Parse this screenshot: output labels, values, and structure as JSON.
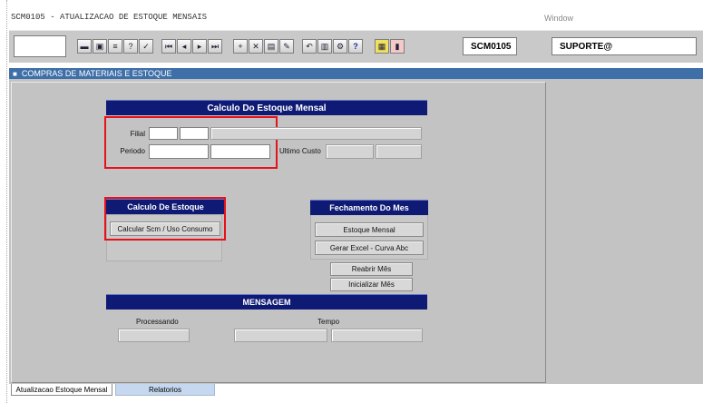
{
  "window": {
    "title": "SCM0105 - ATUALIZACAO DE ESTOQUE MENSAIS",
    "menu_window": "Window"
  },
  "toolbar": {
    "program_code": "SCM0105",
    "user": "SUPORTE@",
    "icons": [
      "save-icon",
      "print-icon",
      "exit-icon",
      "query-icon",
      "query-execute-icon",
      "first-record-icon",
      "previous-record-icon",
      "next-record-icon",
      "last-record-icon",
      "insert-record-icon",
      "delete-record-icon",
      "duplicate-icon",
      "edit-icon",
      "undo-icon",
      "list-icon",
      "tools-icon",
      "help-icon",
      "calculator-icon",
      "chart-icon"
    ]
  },
  "module": {
    "label": "COMPRAS DE MATERIAIS E ESTOQUE"
  },
  "calculo_mensal": {
    "title": "Calculo Do Estoque Mensal",
    "filial_label": "Filial",
    "periodo_label": "Periodo",
    "ultimo_custo_label": "Ultimo Custo"
  },
  "calculo_estoque": {
    "title": "Calculo De Estoque",
    "calcular_button": "Calcular Scm / Uso Consumo"
  },
  "fechamento": {
    "title": "Fechamento Do Mes",
    "estoque_mensal_button": "Estoque Mensal",
    "gerar_excel_button": "Gerar Excel - Curva Abc",
    "reabrir_button": "Reabrir Mês",
    "inicializar_button": "Inicializar Mês"
  },
  "mensagem": {
    "title": "MENSAGEM",
    "processando_label": "Processando",
    "tempo_label": "Tempo"
  },
  "tabs": [
    {
      "label": "Atualizacao Estoque Mensal",
      "active": true
    },
    {
      "label": "Relatorios",
      "active": false
    }
  ],
  "colors": {
    "header": "#0e1a73",
    "module_bar": "#3e6fa8",
    "highlight": "#e8101a",
    "canvas": "#c3c3c3"
  }
}
